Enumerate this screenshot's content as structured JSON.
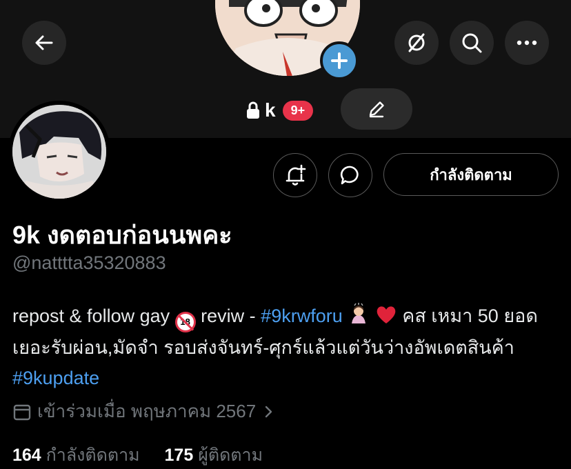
{
  "header": {
    "back_icon": "back-arrow-icon",
    "no_signal_icon": "circle-slash-icon",
    "search_icon": "search-icon",
    "more_icon": "more-dots-icon"
  },
  "account_switcher": {
    "lock_icon": "lock-icon",
    "short_name": "k",
    "notification_badge": "9+",
    "edit_icon": "pencil-icon",
    "add_icon": "plus-icon"
  },
  "profile": {
    "display_name": "9k งดตอบก่อนนพคะ",
    "handle": "@natttta35320883",
    "follow_button_label": "กำลังติดตาม",
    "bio": {
      "part1": "repost & follow gay",
      "part2": "reviw -",
      "hashtag1": "#9krwforu",
      "part3": "คส เหมา 50 ยอดเยอะรับผ่อน,มัดจำ รอบส่งจันทร์-ศุกร์แล้วแต่วันว่างอัพเดตสินค้า",
      "hashtag2": "#9kupdate",
      "no_under_18_label": "18"
    },
    "joined": "เข้าร่วมเมื่อ พฤษภาคม 2567",
    "following_count": "164",
    "following_label": "กำลังติดตาม",
    "followers_count": "175",
    "followers_label": "ผู้ติดตาม"
  },
  "colors": {
    "background": "#000000",
    "accent_link": "#4d9ff0",
    "muted_text": "#71767b",
    "badge_red": "#e8334a",
    "plus_blue": "#4a9ad4"
  }
}
